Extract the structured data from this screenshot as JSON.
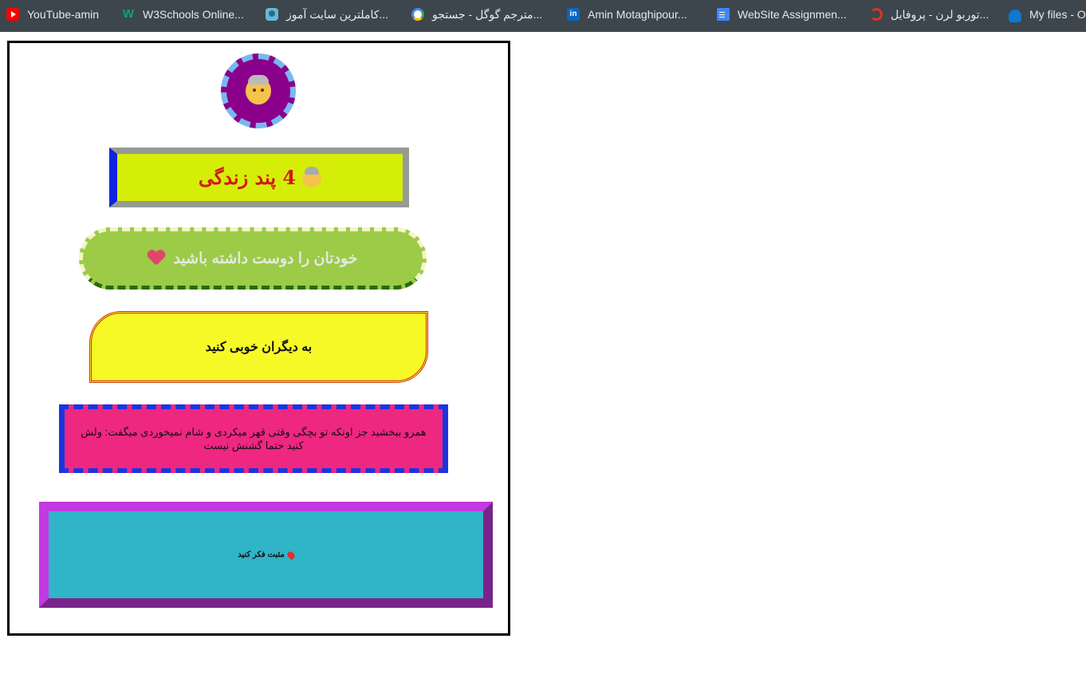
{
  "bookmarks": [
    {
      "label": "YouTube-amin",
      "icon": "youtube-icon"
    },
    {
      "label": "W3Schools Online...",
      "icon": "w3schools-icon"
    },
    {
      "label": "کاملترین سایت آموز...",
      "icon": "bird-icon"
    },
    {
      "label": "مترجم گوگل - جستجو...",
      "icon": "google-icon"
    },
    {
      "label": "Amin Motaghipour...",
      "icon": "linkedin-icon"
    },
    {
      "label": "WebSite Assignmen...",
      "icon": "docs-icon"
    },
    {
      "label": "توربو لرن - پروفایل...",
      "icon": "turbolearn-icon"
    },
    {
      "label": "My files - O",
      "icon": "onedrive-icon"
    }
  ],
  "w3_glyph": "W",
  "linkedin_glyph": "in",
  "boxes": {
    "title": "4 پند زندگی",
    "love_yourself": "خودتان را دوست داشته باشید",
    "be_kind": "به دیگران خوبی کنید",
    "forgive": "همرو ببخشید جز اونکه تو بچگی وقتی قهر میکردی و شام نمیخوردی میگفت: ولش کنید حتما گشنش نیست",
    "think_positive": "مثبت فکر کنید"
  },
  "colors": {
    "title_bg": "#d5ee08",
    "title_text": "#d01818",
    "love_bg": "#9ccb48",
    "kind_bg": "#f7f927",
    "forgive_bg": "#ee2781",
    "positive_bg": "#30b4c8",
    "avatar_bg": "#8b008b"
  }
}
